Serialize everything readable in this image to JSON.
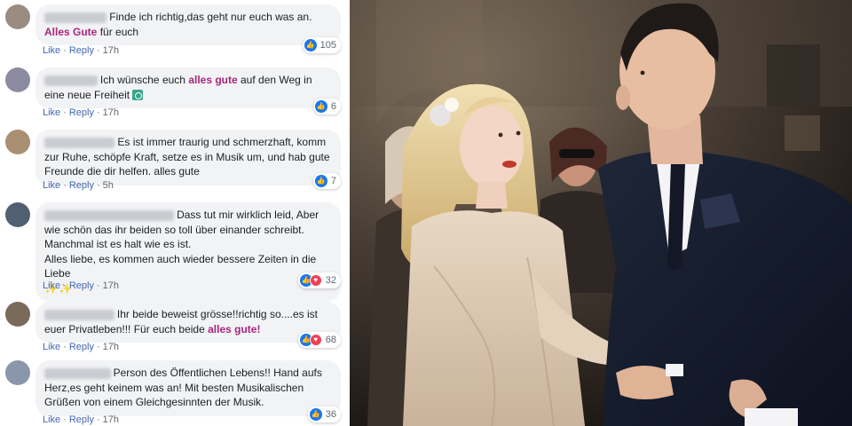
{
  "comments": [
    {
      "name": "Carmen Groß",
      "text_parts": [
        {
          "t": "Finde ich richtig,das geht nur euch was an. ",
          "hl": false
        },
        {
          "t": "Alles Gute",
          "hl": true
        },
        {
          "t": " für euch",
          "hl": false
        }
      ],
      "like": "Like",
      "reply": "Reply",
      "time": "17h",
      "reactions": [
        "like"
      ],
      "count": "105"
    },
    {
      "name": "Anne Jobst",
      "text_parts": [
        {
          "t": "Ich wünsche euch ",
          "hl": false
        },
        {
          "t": "alles gute",
          "hl": true
        },
        {
          "t": " auf den Weg in eine neue Freiheit ",
          "hl": false
        }
      ],
      "emoji": "statue-of-liberty-emoji",
      "like": "Like",
      "reply": "Reply",
      "time": "17h",
      "reactions": [
        "like"
      ],
      "count": "6"
    },
    {
      "name": "Renate Winkler",
      "text_parts": [
        {
          "t": "Es ist immer traurig und schmerzhaft, komm zur Ruhe, schöpfe Kraft, setze es in Musik um, und hab gute Freunde die dir helfen. alles gute",
          "hl": false
        }
      ],
      "like": "Like",
      "reply": "Reply",
      "time": "5h",
      "reactions": [
        "like"
      ],
      "count": "7"
    },
    {
      "name": "Steffi Ifor Bettina Jurasinski",
      "text_parts": [
        {
          "t": "Dass tut mir wirklich leid, Aber wie schön das ihr beiden so toll über einander schreibt. Manchmal ist es halt wie es ist.",
          "hl": false
        },
        {
          "t": "\nAlles liebe, es kommen auch wieder bessere Zeiten in die Liebe ",
          "hl": false
        }
      ],
      "sparkles": "✨✨",
      "like": "Like",
      "reply": "Reply",
      "time": "17h",
      "reactions": [
        "like",
        "love"
      ],
      "count": "32"
    },
    {
      "name": "Gerti Naumann",
      "text_parts": [
        {
          "t": "Ihr beide beweist grösse!!richtig so....es ist euer Privatleben!!! Für euch beide ",
          "hl": false
        },
        {
          "t": "alles gute!",
          "hl": true
        }
      ],
      "like": "Like",
      "reply": "Reply",
      "time": "17h",
      "reactions": [
        "like",
        "love"
      ],
      "count": "68"
    },
    {
      "name": "Elsen Theißen",
      "text_parts": [
        {
          "t": "Person des Öffentlichen Lebens!! Hand aufs Herz,es geht keinem was an! Mit besten Musikalischen Grüßen von einem Gleichgesinnten der Musik.",
          "hl": false
        }
      ],
      "like": "Like",
      "reply": "Reply",
      "time": "17h",
      "reactions": [
        "like"
      ],
      "count": "36"
    }
  ],
  "colors": {
    "highlight": "#a8267e",
    "bubble": "#f2f3f5",
    "link": "#4267b2",
    "like": "#1877f2",
    "love": "#f33e58"
  },
  "photo": {
    "icon": "photo-couple-image"
  }
}
